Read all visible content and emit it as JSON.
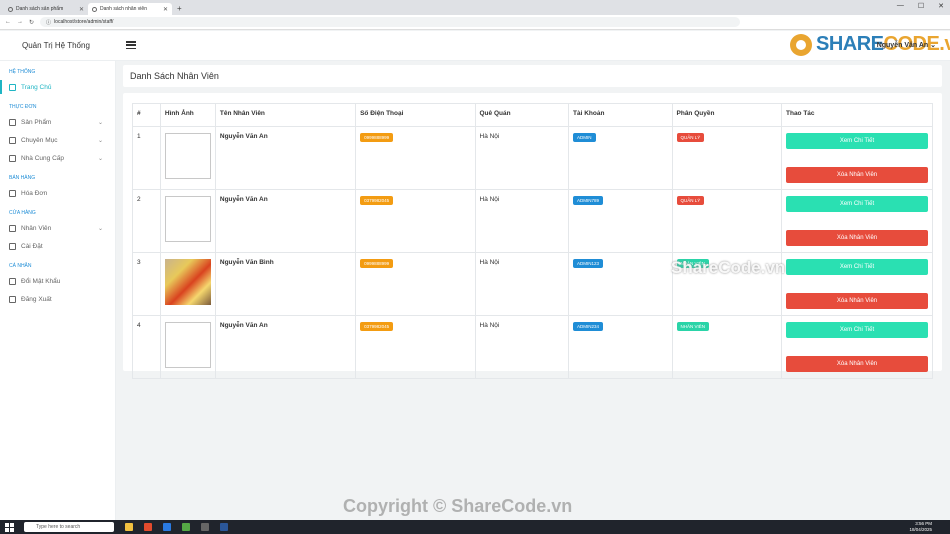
{
  "browser": {
    "tabs": [
      {
        "label": "Danh sách sản phẩm",
        "active": false
      },
      {
        "label": "Danh sách nhân viên",
        "active": true
      }
    ],
    "url": "localhost/store/admin/staff/"
  },
  "header": {
    "brand": "Quản Trị Hệ Thống",
    "user": "Nguyễn Văn An",
    "logo_part1": "SHARE",
    "logo_part2": "CODE.vn"
  },
  "sidebar": {
    "sections": {
      "system": "HỆ THỐNG",
      "menu": "THỰC ĐƠN",
      "sales": "BÁN HÀNG",
      "store": "CỬA HÀNG",
      "personal": "CÁ NHÂN"
    },
    "items": {
      "home": "Trang Chủ",
      "products": "Sản Phẩm",
      "categories": "Chuyên Mục",
      "suppliers": "Nhà Cung Cấp",
      "invoices": "Hóa Đơn",
      "staff": "Nhân Viên",
      "settings": "Cài Đặt",
      "change_password": "Đổi Mật Khẩu",
      "logout": "Đăng Xuất"
    }
  },
  "page": {
    "title": "Danh Sách Nhân Viên",
    "columns": [
      "#",
      "Hình Ảnh",
      "Tên Nhân Viên",
      "Số Điện Thoại",
      "Quê Quán",
      "Tài Khoản",
      "Phân Quyền",
      "Thao Tác"
    ],
    "rows": [
      {
        "no": "1",
        "name": "Nguyễn Văn An",
        "phone": "0999888999",
        "hometown": "Hà Nội",
        "account": "ADMIN",
        "role": "QUẢN LÝ",
        "role_color": "#e74c3c",
        "has_photo": false
      },
      {
        "no": "2",
        "name": "Nguyễn Văn An",
        "phone": "0379982045",
        "hometown": "Hà Nội",
        "account": "ADMIN789",
        "role": "QUẢN LÝ",
        "role_color": "#e74c3c",
        "has_photo": false
      },
      {
        "no": "3",
        "name": "Nguyễn Văn Bình",
        "phone": "0999888999",
        "hometown": "Hà Nội",
        "account": "ADMIN123",
        "role": "NHÂN VIÊN",
        "role_color": "#2ad4a8",
        "has_photo": true
      },
      {
        "no": "4",
        "name": "Nguyễn Văn An",
        "phone": "0379982045",
        "hometown": "Hà Nội",
        "account": "ADMIN234",
        "role": "NHÂN VIÊN",
        "role_color": "#2ad4a8",
        "has_photo": false
      }
    ],
    "view_label": "Xem Chi Tiết",
    "delete_label": "Xóa Nhân Viên"
  },
  "watermarks": {
    "center": "ShareCode.vn",
    "bottom": "Copyright © ShareCode.vn"
  },
  "taskbar": {
    "search_placeholder": "Type here to search",
    "time": "3:56 PM",
    "date": "18/04/2025"
  },
  "colors": {
    "accent": "#1fb5c4",
    "phone_badge": "#f39c12",
    "account_badge": "#1f8dd6",
    "view_button": "#2ae0b2",
    "delete_button": "#e74c3c"
  }
}
